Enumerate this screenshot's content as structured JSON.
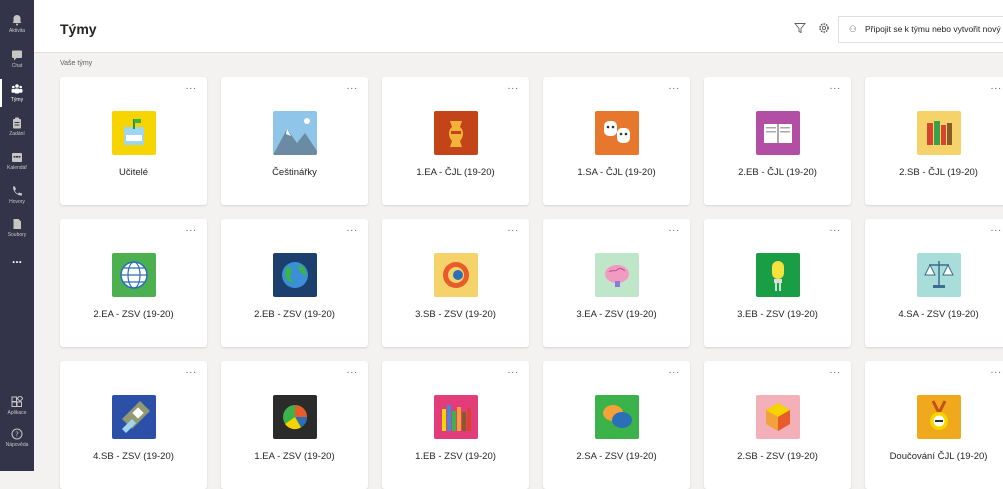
{
  "rail": {
    "items": [
      {
        "label": "Aktivita",
        "icon": "bell-icon"
      },
      {
        "label": "Chat",
        "icon": "chat-icon"
      },
      {
        "label": "Týmy",
        "icon": "teams-icon"
      },
      {
        "label": "Zadání",
        "icon": "assignments-icon"
      },
      {
        "label": "Kalendář",
        "icon": "calendar-icon"
      },
      {
        "label": "Hovory",
        "icon": "phone-icon"
      },
      {
        "label": "Soubory",
        "icon": "files-icon"
      }
    ],
    "more": "...",
    "bottom": [
      {
        "label": "Aplikace",
        "icon": "apps-icon"
      },
      {
        "label": "Nápověda",
        "icon": "help-icon"
      }
    ]
  },
  "header": {
    "title": "Týmy",
    "join_label": "Připojit se k týmu nebo vytvořit nový"
  },
  "section_label": "Vaše týmy",
  "teams": [
    {
      "name": "Učitelé",
      "color": "#f5d400",
      "icon": "mailbox-icon"
    },
    {
      "name": "Češtinářky",
      "color": "#8fc5e8",
      "icon": "mountains-icon"
    },
    {
      "name": "1.EA - ČJL (19-20)",
      "color": "#c4441a",
      "icon": "vase-icon"
    },
    {
      "name": "1.SA - ČJL (19-20)",
      "color": "#e8772e",
      "icon": "theater-masks-icon"
    },
    {
      "name": "2.EB - ČJL (19-20)",
      "color": "#b24fa5",
      "icon": "book-icon"
    },
    {
      "name": "2.SB - ČJL (19-20)",
      "color": "#f6d36a",
      "icon": "books-icon"
    },
    {
      "name": "2.EA - ZSV (19-20)",
      "color": "#4caf50",
      "icon": "globe-grid-icon"
    },
    {
      "name": "2.EB - ZSV (19-20)",
      "color": "#1d3f6e",
      "icon": "earth-icon"
    },
    {
      "name": "3.SB - ZSV (19-20)",
      "color": "#f6d36a",
      "icon": "rings-icon"
    },
    {
      "name": "3.EA - ZSV (19-20)",
      "color": "#bfe6c9",
      "icon": "brain-icon"
    },
    {
      "name": "3.EB - ZSV (19-20)",
      "color": "#1a9e45",
      "icon": "lightbulb-icon"
    },
    {
      "name": "4.SA - ZSV (19-20)",
      "color": "#a8ddd9",
      "icon": "scales-icon"
    },
    {
      "name": "4.SB - ZSV (19-20)",
      "color": "#2c4fa8",
      "icon": "flashlight-icon"
    },
    {
      "name": "1.EA - ZSV (19-20)",
      "color": "#2b2b2b",
      "icon": "pie-icon"
    },
    {
      "name": "1.EB - ZSV (19-20)",
      "color": "#e23c7a",
      "icon": "pencils-icon"
    },
    {
      "name": "2.SA - ZSV (19-20)",
      "color": "#3bb24a",
      "icon": "speech-bubbles-icon"
    },
    {
      "name": "2.SB - ZSV (19-20)",
      "color": "#f3b0b8",
      "icon": "hexagon-icon"
    },
    {
      "name": "Doučování ČJL (19-20)",
      "color": "#f0a81c",
      "icon": "medal-icon"
    }
  ],
  "card_more": "..."
}
